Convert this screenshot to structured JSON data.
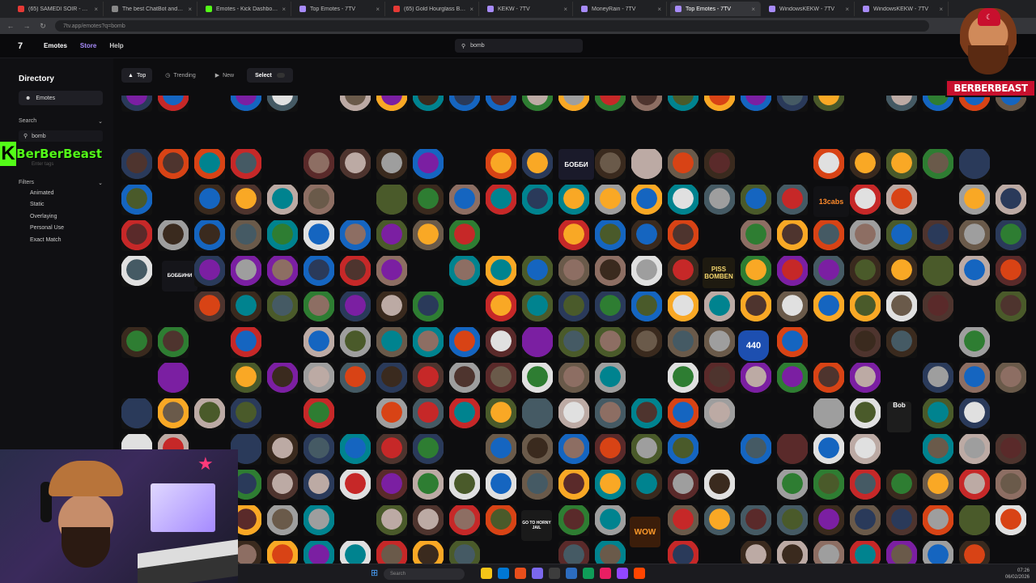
{
  "browser": {
    "tabs": [
      {
        "label": "(65) SAMEDI SOIR - YouT",
        "color": "#e53935",
        "active": false
      },
      {
        "label": "The best ChatBot and Widge",
        "color": "#888888",
        "active": false
      },
      {
        "label": "Emotes - Kick Dashboard",
        "color": "#53fc18",
        "active": false
      },
      {
        "label": "Top Emotes - 7TV",
        "color": "#a78bfa",
        "active": false
      },
      {
        "label": "(65) Gold Hourglass Backgr",
        "color": "#e53935",
        "active": false
      },
      {
        "label": "KEKW - 7TV",
        "color": "#a78bfa",
        "active": false
      },
      {
        "label": "MoneyRain - 7TV",
        "color": "#a78bfa",
        "active": false
      },
      {
        "label": "Top Emotes - 7TV",
        "color": "#a78bfa",
        "active": true
      },
      {
        "label": "WindowsKEKW - 7TV",
        "color": "#a78bfa",
        "active": false
      },
      {
        "label": "WindowsKEKW - 7TV",
        "color": "#a78bfa",
        "active": false
      }
    ],
    "url": "7tv.app/emotes?q=bomb"
  },
  "site": {
    "nav": {
      "emotes": "Emotes",
      "store": "Store",
      "help": "Help"
    },
    "search_value": "bomb"
  },
  "sidebar": {
    "title": "Directory",
    "selected_item": "Emotes",
    "search_label": "Search",
    "search_value": "bomb",
    "tag_search_placeholder": "Enter tags",
    "filters_label": "Filters",
    "filters": [
      "Animated",
      "Static",
      "Overlaying",
      "Personal Use",
      "Exact Match"
    ]
  },
  "sortbar": {
    "top": "Top",
    "trending": "Trending",
    "new": "New",
    "select": "Select"
  },
  "overlay": {
    "kick_logo_text": "BerBerBeast",
    "brand_name": "BERBERBEAST"
  },
  "emote_labels": {
    "bobbi": "БОББИ",
    "bobbini": "БОББИНИ",
    "cabs": "13cabs",
    "piss_line1": "PISS",
    "piss_line2": "BOMBEN",
    "route": "440",
    "bob": "Bob",
    "wow": "WOW",
    "jail": "GO TO HORNY JAIL"
  },
  "taskbar": {
    "search_placeholder": "Search",
    "time": "07:26",
    "date": "06/02/2026"
  }
}
